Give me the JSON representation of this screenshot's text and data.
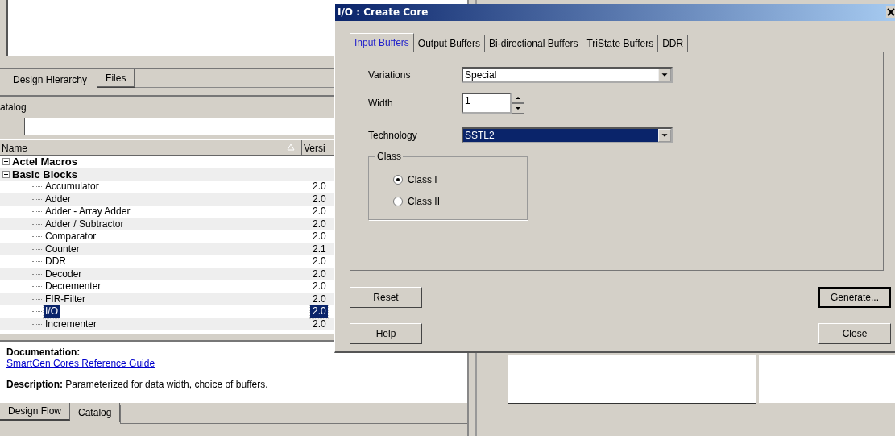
{
  "top_tabs": [
    {
      "label": "Design Hierarchy",
      "selected": true
    },
    {
      "label": "Files",
      "selected": false
    }
  ],
  "catalog": {
    "title": "atalog",
    "columns": [
      "Name",
      "Versi"
    ],
    "groups": [
      {
        "label": "Actel Macros",
        "expanded": false
      },
      {
        "label": "Basic Blocks",
        "expanded": true,
        "children": [
          {
            "name": "Accumulator",
            "version": "2.0",
            "selected": false
          },
          {
            "name": "Adder",
            "version": "2.0",
            "selected": false
          },
          {
            "name": "Adder - Array Adder",
            "version": "2.0",
            "selected": false
          },
          {
            "name": "Adder / Subtractor",
            "version": "2.0",
            "selected": false
          },
          {
            "name": "Comparator",
            "version": "2.0",
            "selected": false
          },
          {
            "name": "Counter",
            "version": "2.1",
            "selected": false
          },
          {
            "name": "DDR",
            "version": "2.0",
            "selected": false
          },
          {
            "name": "Decoder",
            "version": "2.0",
            "selected": false
          },
          {
            "name": "Decrementer",
            "version": "2.0",
            "selected": false
          },
          {
            "name": "FIR-Filter",
            "version": "2.0",
            "selected": false
          },
          {
            "name": "I/O",
            "version": "2.0",
            "selected": true
          },
          {
            "name": "Incrementer",
            "version": "2.0",
            "selected": false
          }
        ]
      }
    ]
  },
  "documentation": {
    "heading": "Documentation:",
    "link": "SmartGen Cores Reference Guide",
    "description": "**Description:** Parameterized for data width, choice of buffers."
  },
  "bottom_tabs": [
    {
      "label": "Design Flow",
      "selected": false
    },
    {
      "label": "Catalog",
      "selected": true
    }
  ],
  "dialog": {
    "title": "I/O : Create Core",
    "tabs": [
      {
        "label": "Input Buffers",
        "selected": true
      },
      {
        "label": "Output Buffers",
        "selected": false
      },
      {
        "label": "Bi-directional Buffers",
        "selected": false
      },
      {
        "label": "TriState Buffers",
        "selected": false
      },
      {
        "label": "DDR",
        "selected": false
      }
    ],
    "fields": [
      {
        "kind": "dropdown",
        "label": "Variations",
        "value": "Special",
        "highlighted": false
      },
      {
        "kind": "spinner",
        "label": "Width",
        "value": "1"
      },
      {
        "kind": "dropdown",
        "label": "Technology",
        "value": "SSTL2",
        "highlighted": true
      }
    ],
    "class_group": {
      "title": "Class",
      "options": [
        {
          "label": "Class I",
          "selected": true
        },
        {
          "label": "Class II",
          "selected": false
        }
      ]
    },
    "buttons_left": [
      "Reset",
      "Help"
    ],
    "buttons_right": [
      "Generate...",
      "Close"
    ]
  }
}
